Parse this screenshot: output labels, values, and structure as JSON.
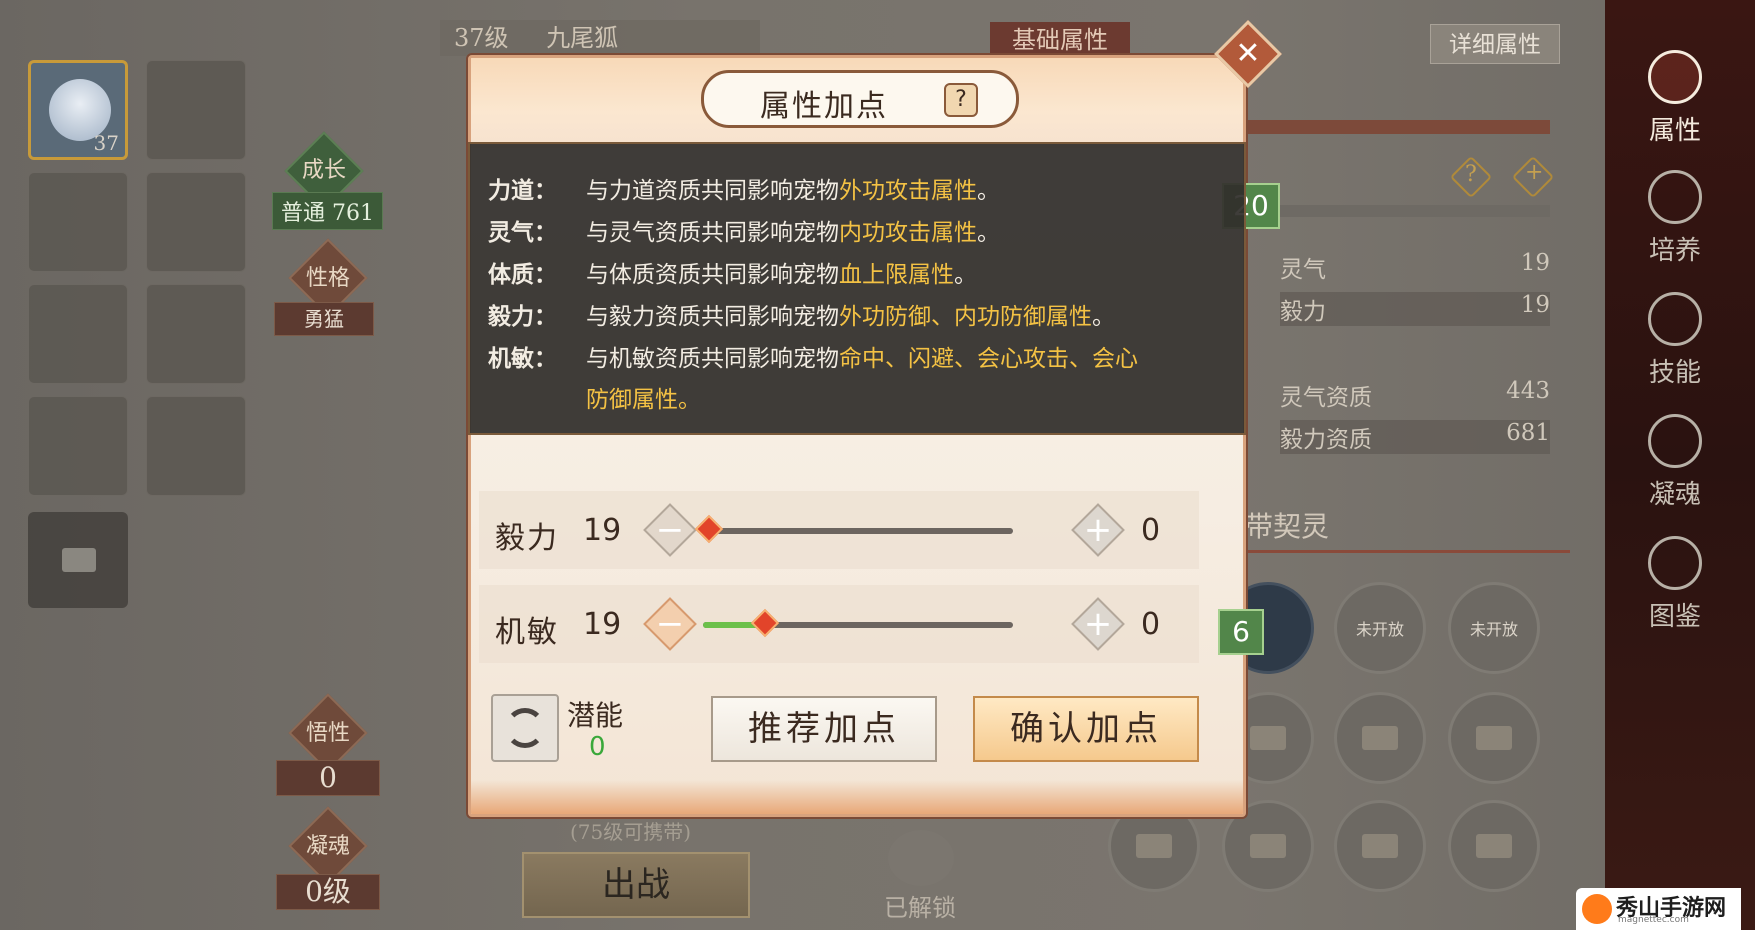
{
  "left": {
    "active_pet_level": "37",
    "growth_label": "成长",
    "growth_type": "普通",
    "growth_value": "761",
    "personality_label": "性格",
    "personality_value": "勇猛",
    "comprehension_label": "悟性",
    "comprehension_value": "0",
    "soul_label": "凝魂",
    "soul_value": "0级"
  },
  "header": {
    "level": "37级",
    "pet_name": "九尾狐",
    "base_attr_tab": "基础属性",
    "detail_button": "详细属性"
  },
  "right_panel": {
    "side_tag_top": "20",
    "rows": [
      {
        "label": "灵气",
        "value": "19"
      },
      {
        "label": "毅力",
        "value": "19"
      },
      {
        "label": "灵气资质",
        "value": "443"
      },
      {
        "label": "毅力资质",
        "value": "681"
      }
    ],
    "contract_title": "带契灵",
    "not_open_1": "未开放",
    "not_open_2": "未开放"
  },
  "nav": {
    "attr": "属性",
    "train": "培养",
    "skill": "技能",
    "soul": "凝魂",
    "atlas": "图鉴"
  },
  "bottom": {
    "carry_note": "(75级可携带)",
    "battle_button": "出战",
    "unlocked": "已解锁"
  },
  "dialog": {
    "title": "属性加点",
    "help": "?",
    "close": "✕",
    "tooltip": {
      "rows": [
        {
          "label": "力道：",
          "pre": "与力道资质共同影响宠物",
          "hl": "外功攻击属性",
          "post": "。"
        },
        {
          "label": "灵气：",
          "pre": "与灵气资质共同影响宠物",
          "hl": "内功攻击属性",
          "post": "。"
        },
        {
          "label": "体质：",
          "pre": "与体质资质共同影响宠物",
          "hl": "血上限属性",
          "post": "。"
        },
        {
          "label": "毅力：",
          "pre": "与毅力资质共同影响宠物",
          "hl": "外功防御、内功防御属性",
          "post": "。"
        },
        {
          "label": "机敏：",
          "pre": "与机敏资质共同影响宠物",
          "hl": "命中、闪避、会心攻击、会心",
          "post": ""
        }
      ],
      "continuation": "防御属性。"
    },
    "attributes": [
      {
        "name": "毅力",
        "value": "19",
        "added": "0",
        "fill": 0.0
      },
      {
        "name": "机敏",
        "value": "19",
        "added": "0",
        "fill": 0.19,
        "tag": "6"
      }
    ],
    "potential_label": "潜能",
    "potential_value": "0",
    "recommend_button": "推荐加点",
    "confirm_button": "确认加点"
  },
  "watermark": {
    "name": "秀山手游网",
    "url": "magnettec.com"
  }
}
